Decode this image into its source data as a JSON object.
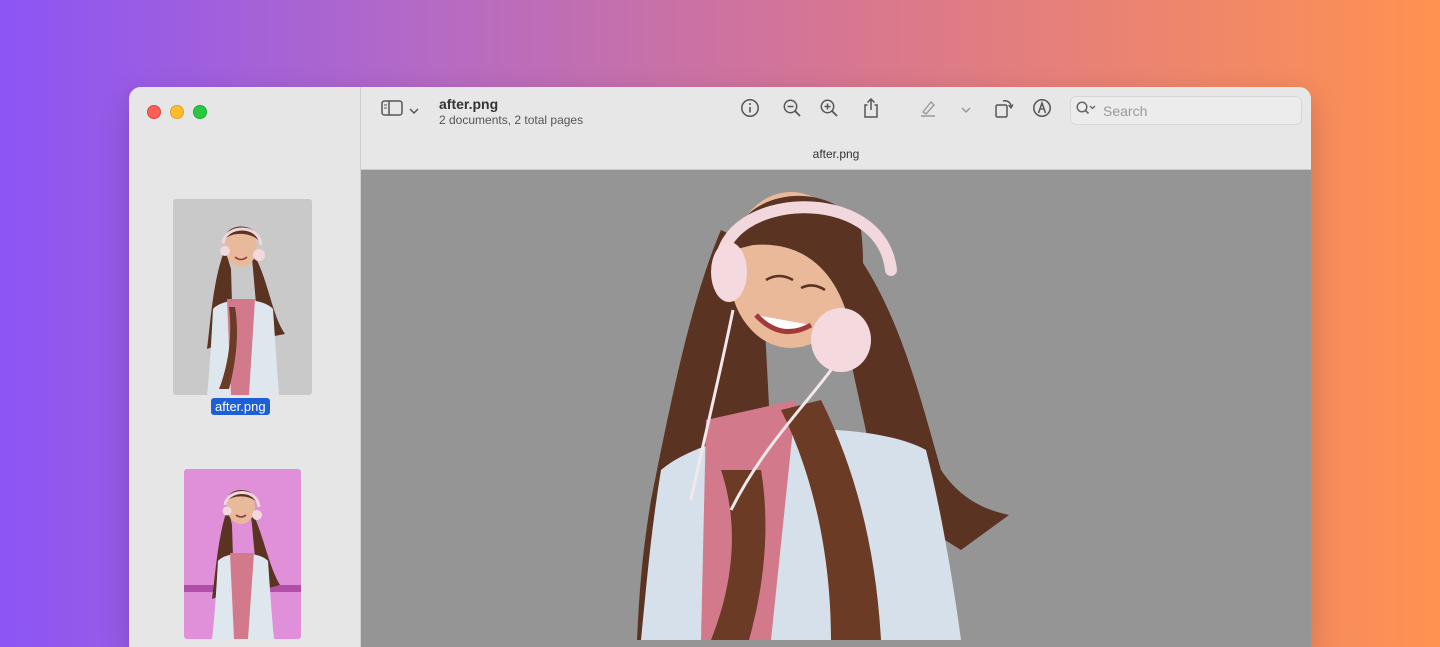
{
  "window": {
    "document_title": "after.png",
    "document_subtitle": "2 documents, 2 total pages",
    "tab_title": "after.png"
  },
  "sidebar": {
    "thumbnails": [
      {
        "label": "after.png",
        "selected": true,
        "background": "#c9c9c9"
      },
      {
        "label": "",
        "selected": false,
        "background": "#e090d8"
      }
    ]
  },
  "toolbar": {
    "icons": [
      "sidebar-icon",
      "chevron-down-icon",
      "info-icon",
      "zoom-out-icon",
      "zoom-in-icon",
      "share-icon",
      "highlight-icon",
      "chevron-down-icon",
      "rotate-icon",
      "markup-icon"
    ]
  },
  "search": {
    "placeholder": "Search",
    "value": ""
  },
  "colors": {
    "accent": "#1c5fd6",
    "canvas": "#959595",
    "traffic_red": "#fe5f57",
    "traffic_yellow": "#febc2e",
    "traffic_green": "#28c840"
  }
}
